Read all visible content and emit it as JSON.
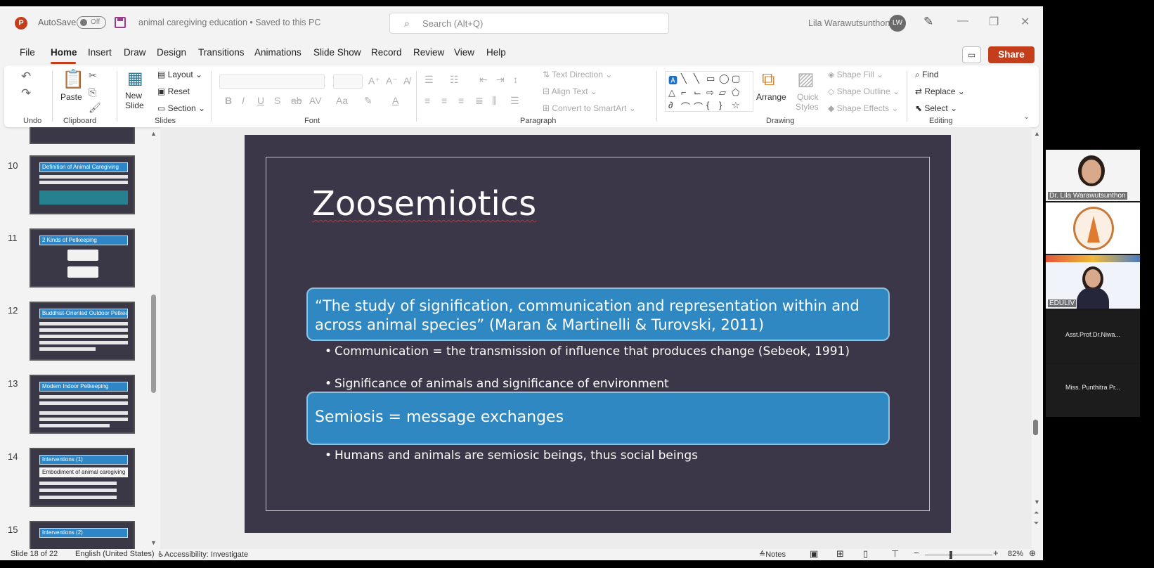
{
  "titlebar": {
    "app_icon": "P",
    "autosave_label": "AutoSave",
    "autosave_state": "Off",
    "document_title": "animal caregiving education • Saved to this PC",
    "search_placeholder": "Search (Alt+Q)",
    "user_name": "Lila Warawutsunthon",
    "user_initials": "LW"
  },
  "menu": {
    "items": [
      "File",
      "Home",
      "Insert",
      "Draw",
      "Design",
      "Transitions",
      "Animations",
      "Slide Show",
      "Record",
      "Review",
      "View",
      "Help"
    ],
    "active": "Home",
    "share_label": "Share"
  },
  "ribbon": {
    "groups": {
      "undo": "Undo",
      "clipboard": "Clipboard",
      "slides": "Slides",
      "font": "Font",
      "paragraph": "Paragraph",
      "drawing": "Drawing",
      "editing": "Editing"
    },
    "paste": "Paste",
    "new_slide_1": "New",
    "new_slide_2": "Slide",
    "layout": "Layout",
    "reset": "Reset",
    "section": "Section",
    "text_direction": "Text Direction",
    "align_text": "Align Text",
    "convert_smartart": "Convert to SmartArt",
    "arrange": "Arrange",
    "quick_styles_1": "Quick",
    "quick_styles_2": "Styles",
    "shape_fill": "Shape Fill",
    "shape_outline": "Shape Outline",
    "shape_effects": "Shape Effects",
    "find": "Find",
    "replace": "Replace",
    "select": "Select"
  },
  "thumbnails": [
    {
      "num": "10",
      "title": "Definition of Animal Caregiving"
    },
    {
      "num": "11",
      "title": "2 Kinds of Petkeeping"
    },
    {
      "num": "12",
      "title": "Buddhist-Oriented Outdoor Petkeeping"
    },
    {
      "num": "13",
      "title": "Modern Indoor Petkeeping"
    },
    {
      "num": "14",
      "title": "Interventions (1)",
      "sub": "Embodiment of animal caregiving"
    },
    {
      "num": "15",
      "title": "Interventions (2)"
    }
  ],
  "slide": {
    "title": "Zoosemiotics",
    "callout1": "“The study of signification, communication and representation within and across animal species” (Maran & Martinelli & Turovski, 2011)",
    "bullet1": "Communication = the transmission of influence that produces change (Sebeok, 1991)",
    "bullet2": "Significance of animals and significance of environment",
    "callout2": "Semiosis = message exchanges",
    "bullet3": "Humans and animals are semiosic beings, thus social beings"
  },
  "status": {
    "slide_counter": "Slide 18 of 22",
    "language": "English (United States)",
    "accessibility": "Accessibility: Investigate",
    "notes": "Notes",
    "zoom": "82%"
  },
  "video_panel": {
    "participants": [
      "Dr. Lila Warawutsunthon",
      "EDULIV",
      "Asst.Prof.Dr.Niwa...",
      "Miss. Punthitra Pr..."
    ]
  },
  "colors": {
    "accent": "#c43e1c",
    "slide_bg": "#3b3749",
    "callout_fill": "#2f88c1"
  }
}
